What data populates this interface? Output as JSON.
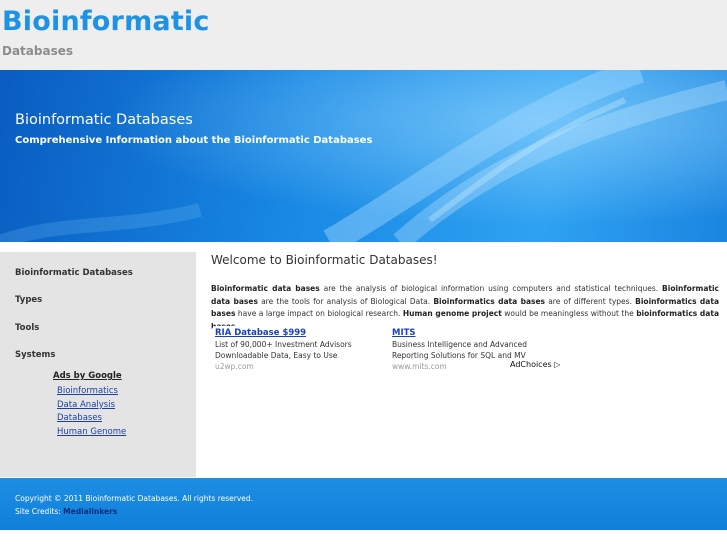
{
  "header": {
    "title": "Bioinformatic",
    "subtitle": "Databases"
  },
  "hero": {
    "title": "Bioinformatic Databases",
    "tagline": "Comprehensive Information about the Bioinformatic Databases"
  },
  "sidebar": {
    "items": [
      {
        "label": "Bioinformatic Databases"
      },
      {
        "label": "Types"
      },
      {
        "label": "Tools"
      },
      {
        "label": "Systems"
      }
    ],
    "ads_heading": "Ads by Google",
    "ad_links": [
      "Bioinformatics",
      "Data Analysis",
      "Databases",
      "Human Genome"
    ]
  },
  "main": {
    "welcome": "Welcome to Bioinformatic Databases!",
    "intro": [
      {
        "b": true,
        "t": "Bioinformatic data bases"
      },
      {
        "b": false,
        "t": " are the analysis of biological information using computers and statistical techniques. "
      },
      {
        "b": true,
        "t": "Bioinformatic data bases"
      },
      {
        "b": false,
        "t": " are the tools for analysis of Biological Data. "
      },
      {
        "b": true,
        "t": "Bioinformatics data bases"
      },
      {
        "b": false,
        "t": " are of different types. "
      },
      {
        "b": true,
        "t": "Bioinformatics data bases"
      },
      {
        "b": false,
        "t": " have a large impact on biological research. "
      },
      {
        "b": true,
        "t": "Human genome project"
      },
      {
        "b": false,
        "t": " would be meaningless without the "
      },
      {
        "b": true,
        "t": "bioinformatics data bases"
      },
      {
        "b": false,
        "t": "."
      }
    ]
  },
  "ads": [
    {
      "title": "RIA Database $999",
      "line1": "List of 90,000+ Investment Advisors",
      "line2": "Downloadable Data, Easy to Use",
      "url": "u2wp.com"
    },
    {
      "title": "MITS",
      "line1": "Business Intelligence and Advanced",
      "line2": "Reporting Solutions for SQL and MV",
      "url": "www.mits.com"
    }
  ],
  "adchoices": "AdChoices ▷",
  "footer": {
    "copyright": "Copyright © 2011 Bioinformatic Databases. All rights reserved.",
    "credits_label": "Site Credits: ",
    "credits_link": "Medialinkers"
  },
  "colors": {
    "brand": "#1e93e6",
    "hero": "#1787e3",
    "sidebar": "#e4e4e4",
    "footer": "#1e8ee4"
  }
}
